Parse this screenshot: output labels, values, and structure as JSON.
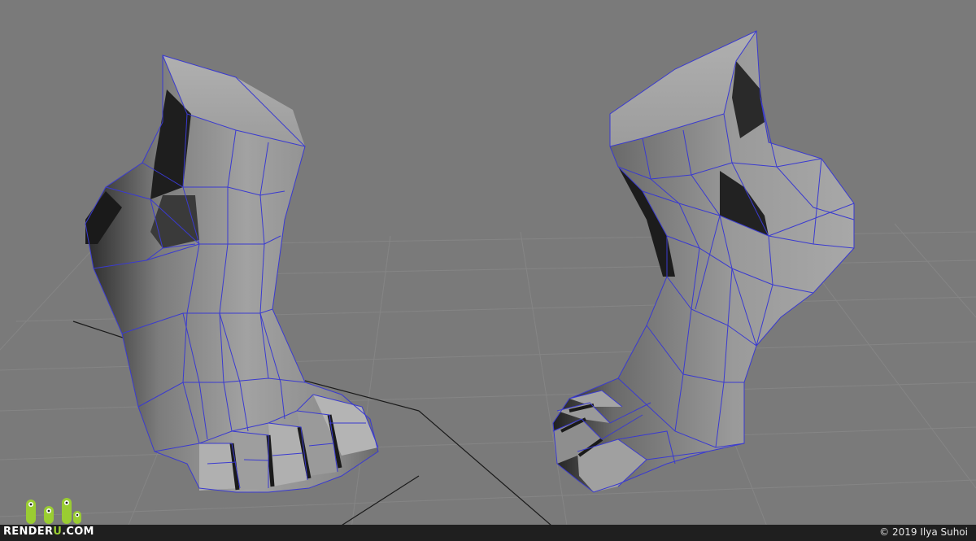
{
  "image": {
    "subject": "Two low-poly 3D feet meshes with wireframe over a grid",
    "background_color": "#7a7a7a",
    "wire_color": "#3a3ad0",
    "grid_color": "#8a8a8a"
  },
  "watermark": {
    "logo_text_start": "RENDER",
    "logo_text_accent": "U",
    "logo_text_end": ".COM",
    "logo_accent_color": "#9acd32",
    "copyright": "© 2019 Ilya Suhoi"
  }
}
